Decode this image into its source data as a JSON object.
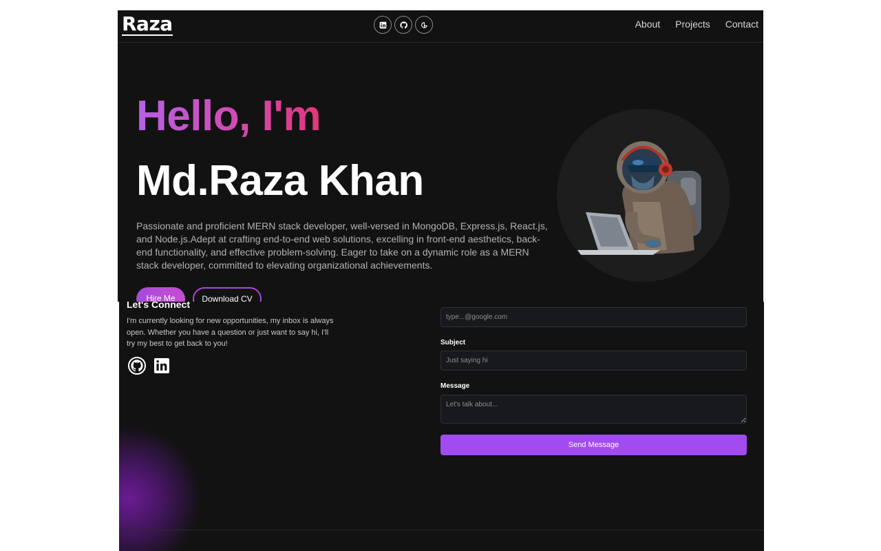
{
  "header": {
    "logo": "Raza",
    "social_icons": [
      "linkedin-icon",
      "github-icon",
      "gfg-icon"
    ],
    "nav": [
      "About",
      "Projects",
      "Contact"
    ]
  },
  "hero": {
    "greeting": "Hello, I'm",
    "name": "Md.Raza Khan",
    "bio": "Passionate and proficient MERN stack developer, well-versed in MongoDB, Express.js, React.js, and Node.js.Adept at crafting end-to-end web solutions, excelling in front-end aesthetics, back-end functionality, and effective problem-solving. Eager to take on a dynamic role as a MERN stack developer, committed to elevating organizational achievements.",
    "hire_label": "Hire Me",
    "cv_label": "Download CV"
  },
  "connect": {
    "title": "Let's Connect",
    "text": "I'm currently looking for new opportunities, my inbox is always open. Whether you have a question or just want to say hi, I'll try my best to get back to you!",
    "icons": [
      "github-icon",
      "linkedin-icon"
    ]
  },
  "form": {
    "email_placeholder": "type...@google.com",
    "subject_label": "Subject",
    "subject_placeholder": "Just saying hi",
    "message_label": "Message",
    "message_placeholder": "Let's talk about...",
    "send_label": "Send Message"
  },
  "colors": {
    "background": "#121212",
    "accent": "#a24bf0",
    "gradient_start": "#b661e6",
    "gradient_end": "#e2367a"
  }
}
